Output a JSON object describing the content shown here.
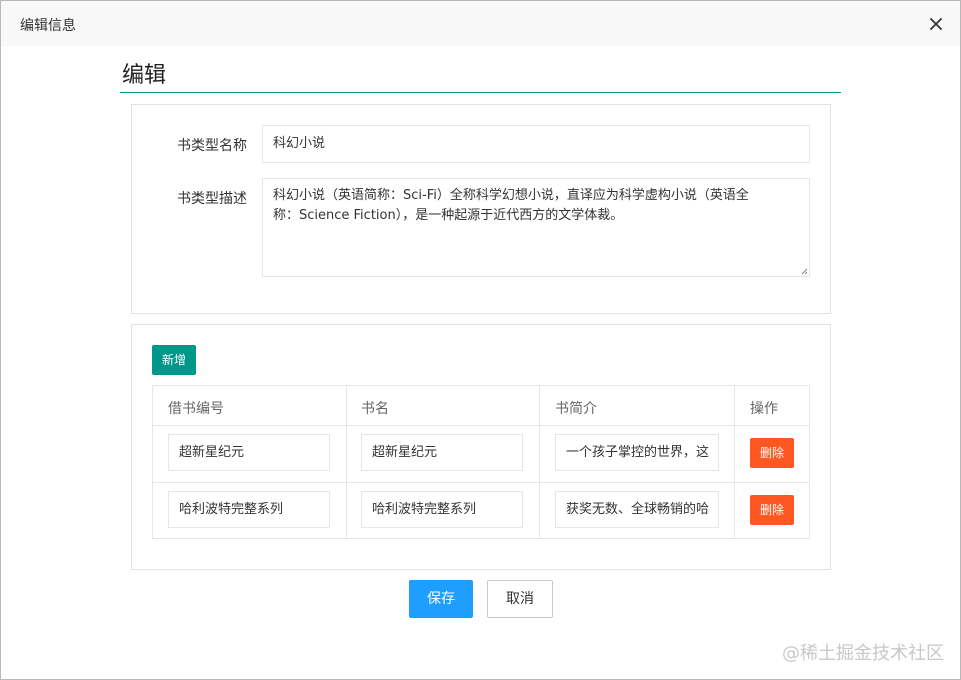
{
  "dialog": {
    "title": "编辑信息",
    "close_icon": "close-icon"
  },
  "section": {
    "title": "编辑"
  },
  "form": {
    "name_label": "书类型名称",
    "name_value": "科幻小说",
    "desc_label": "书类型描述",
    "desc_line1": "科幻小说（英语简称：Sci-Fi）全称科学幻想小说，直译应为科学虚构小说（英语全",
    "desc_line2": "称：Science Fiction），是一种起源于近代西方的文学体裁。"
  },
  "table": {
    "add_label": "新增",
    "headers": [
      "借书编号",
      "书名",
      "书简介",
      "操作"
    ],
    "rows": [
      {
        "id": "超新星纪元",
        "name": "超新星纪元",
        "intro": "一个孩子掌控的世界，这",
        "action": "删除"
      },
      {
        "id": "哈利波特完整系列",
        "name": "哈利波特完整系列",
        "intro": "获奖无数、全球畅销的哈",
        "action": "删除"
      }
    ]
  },
  "footer": {
    "save_label": "保存",
    "cancel_label": "取消"
  },
  "watermark": "@稀土掘金技术社区",
  "colors": {
    "primary": "#009688",
    "save": "#1e9fff",
    "danger": "#ff5722"
  }
}
